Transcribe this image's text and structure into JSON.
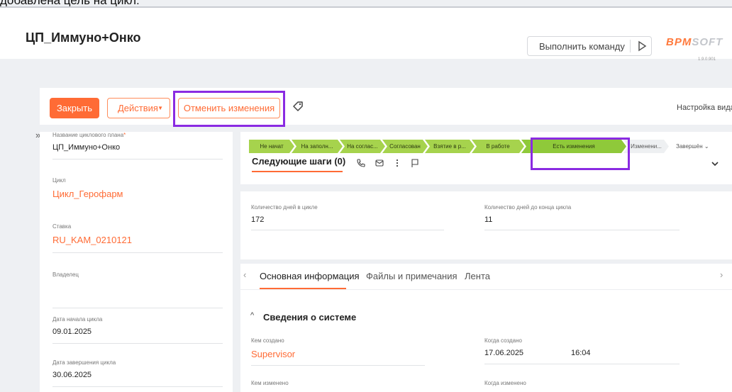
{
  "caption": "добавлена цель на цикл:",
  "header": {
    "title": "ЦП_Иммуно+Онко",
    "command_label": "Выполнить команду",
    "logo_main": "BPM",
    "logo_soft": "SOFT",
    "version": "1.9.0.901"
  },
  "actions": {
    "close_label": "Закрыть",
    "actions_label": "Действия",
    "cancel_label": "Отменить изменения",
    "settings_label": "Настройка вида"
  },
  "left_fields": [
    {
      "label": "Название циклового плана",
      "value": "ЦП_Иммуно+Онко"
    },
    {
      "label": "Цикл",
      "value": "Цикл_Герофарм"
    },
    {
      "label": "Ставка",
      "value": "RU_KAM_0210121"
    },
    {
      "label": "Владелец",
      "value": ""
    },
    {
      "label": "Дата начала цикла",
      "value": "09.01.2025"
    },
    {
      "label": "Дата завершения цикла",
      "value": "30.06.2025"
    }
  ],
  "stages": [
    "Не начат",
    "На заполн...",
    "На соглас...",
    "Согласован",
    "Взятие в р...",
    "В работе",
    "Есть изменения",
    "Изменени...",
    "Завершён"
  ],
  "next_steps": {
    "label": "Следующие шаги (0)"
  },
  "counts": [
    {
      "label": "Количество дней в цикле",
      "value": "172"
    },
    {
      "label": "Количество дней до конца цикла",
      "value": "11"
    }
  ],
  "tabs": [
    "Основная информация",
    "Файлы и примечания",
    "Лента"
  ],
  "system_section": {
    "title": "Сведения о системе",
    "created_by_label": "Кем создано",
    "created_by": "Supervisor",
    "created_on_label": "Когда создано",
    "created_date": "17.06.2025",
    "created_time": "16:04",
    "modified_by_label": "Кем изменено",
    "modified_on_label": "Когда изменено"
  },
  "colors": {
    "accent": "#ff6b35",
    "stage_done": "#a6d34d",
    "highlight": "#8a2be2"
  }
}
